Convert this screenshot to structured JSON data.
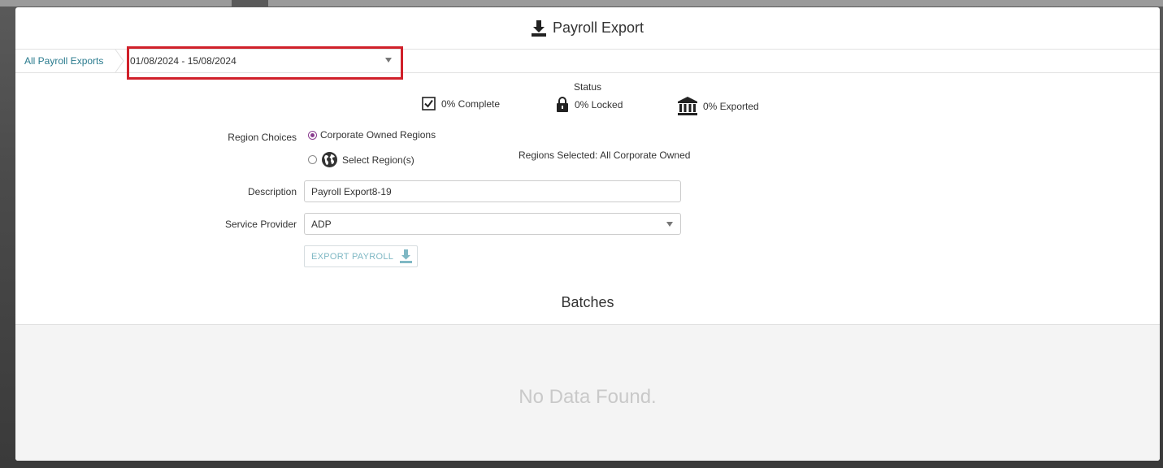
{
  "header": {
    "title": "Payroll Export",
    "icon": "download-icon"
  },
  "toolbar": {
    "breadcrumb": "All Payroll Exports",
    "date_range": "01/08/2024 - 15/08/2024"
  },
  "status": {
    "label": "Status",
    "complete": "0% Complete",
    "locked": "0% Locked",
    "exported": "0% Exported"
  },
  "form": {
    "region_label": "Region Choices",
    "region_option_corporate": "Corporate Owned Regions",
    "region_option_select": "Select Region(s)",
    "regions_selected": "Regions Selected: All Corporate Owned",
    "description_label": "Description",
    "description_value": "Payroll Export8-19",
    "provider_label": "Service Provider",
    "provider_value": "ADP",
    "export_button": "EXPORT PAYROLL"
  },
  "batches": {
    "title": "Batches",
    "empty_text": "No Data Found."
  },
  "colors": {
    "accent_link": "#2a7b8e",
    "radio_selected": "#8a3c8f",
    "highlight_box": "#d0202a",
    "export_button_text": "#7fb8c4"
  }
}
